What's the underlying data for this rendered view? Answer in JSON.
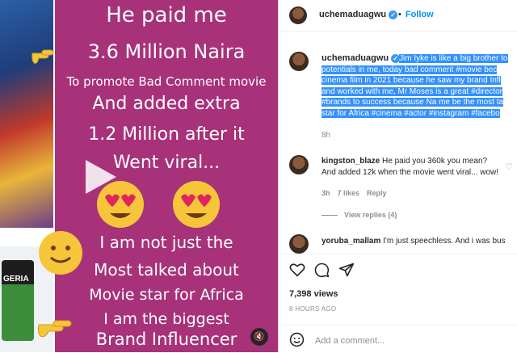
{
  "media": {
    "lines": [
      "He paid me",
      "3.6 Million Naira",
      "To promote Bad Comment movie",
      "And added extra",
      "1.2 Million after it",
      "Went viral...",
      "I am not just the",
      "Most talked about",
      "Movie star for Africa",
      "I am the biggest",
      "Brand Influencer"
    ],
    "cup_text": "GERIA"
  },
  "header": {
    "username": "uchemaduagwu",
    "separator": "•",
    "follow_label": "Follow",
    "more_label": "..."
  },
  "caption": {
    "username": "uchemaduagwu",
    "lines": [
      "Jim Iyke is like a big brother to",
      "potentials in me, today bad comment #movie bec",
      "cinema film in 2021 because he saw my brand Infl",
      "and worked with me, Mr Moses is a great #director",
      "#brands to success because Na me be the most ta",
      "star for Africa #cinema #actor #instagram #facebo"
    ],
    "time": "8h"
  },
  "comments": [
    {
      "username": "kingston_blaze",
      "line1": "He paid you 360k you mean?",
      "line2": "And added 12k when the movie went viral... wow!",
      "time": "3h",
      "likes": "7 likes",
      "reply": "Reply",
      "view_replies": "View replies (4)"
    },
    {
      "username": "yoruba_mallam",
      "line1": "I'm just speechless. And i was bus"
    }
  ],
  "footer": {
    "views": "7,398 views",
    "ago": "8 HOURS AGO",
    "add_comment_placeholder": "Add a comment..."
  },
  "colors": {
    "media_bg": "#a8327a",
    "highlight": "#3390ff",
    "link": "#0095f6",
    "verified": "#3897f0"
  }
}
